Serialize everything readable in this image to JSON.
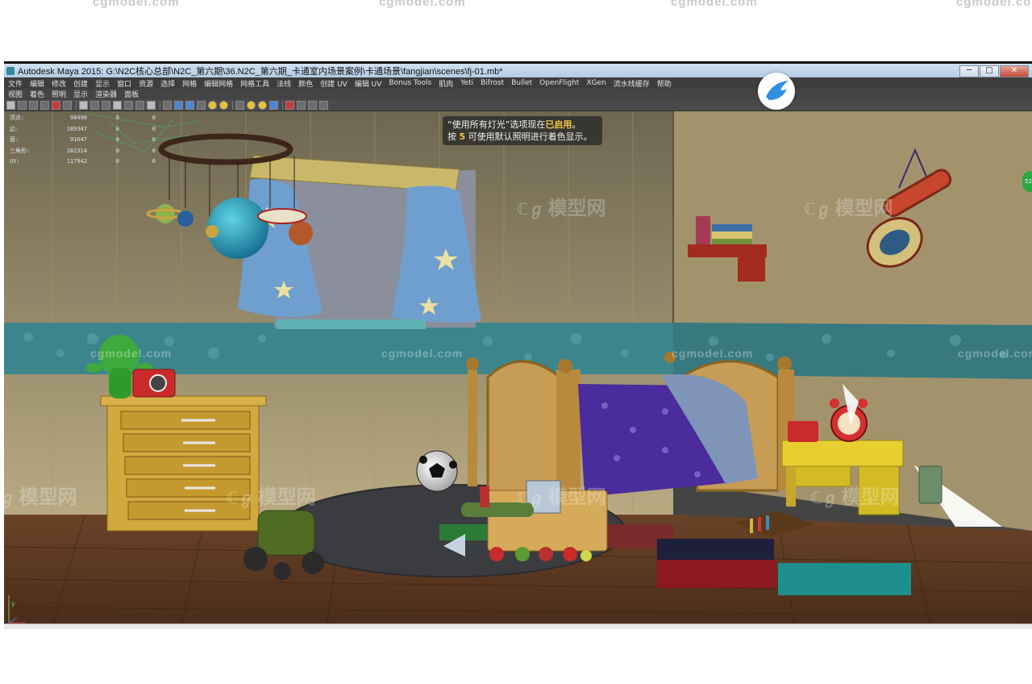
{
  "watermark": {
    "site": "cgmodel.com",
    "cn": "模型网",
    "cn_mark": "ℂℊ"
  },
  "window": {
    "title": "Autodesk Maya 2015: G:\\N2C核心总部\\N2C_第六期\\36.N2C_第六期_卡通室内场景案例\\卡通场景\\fangjian\\scenes\\fj-01.mb*",
    "btn_min": "─",
    "btn_max": "□",
    "btn_close": "✕"
  },
  "menubar": [
    "文件",
    "编辑",
    "修改",
    "创建",
    "显示",
    "窗口",
    "资源",
    "选择",
    "网格",
    "编辑网格",
    "网格工具",
    "法线",
    "颜色",
    "创建 UV",
    "编辑 UV",
    "Bonus Tools",
    "肌肉",
    "Yeti",
    "Bifrost",
    "Bullet",
    "OpenFlight",
    "XGen",
    "流水线缓存",
    "帮助"
  ],
  "panel_menu": [
    "视图",
    "着色",
    "照明",
    "显示",
    "渲染器",
    "面板"
  ],
  "hud": {
    "rows": [
      {
        "label": "顶点:",
        "v1": "98498",
        "v2": "0",
        "v3": "0"
      },
      {
        "label": "边:",
        "v1": "189347",
        "v2": "0",
        "v3": "0"
      },
      {
        "label": "面:",
        "v1": "91647",
        "v2": "0",
        "v3": "0"
      },
      {
        "label": "三角形:",
        "v1": "182314",
        "v2": "0",
        "v3": "0"
      },
      {
        "label": "UV:",
        "v1": "117942",
        "v2": "0",
        "v3": "0"
      }
    ]
  },
  "notice": {
    "line1_pre": "“使用所有灯光”选项现在",
    "line1_hl": "已启用",
    "line1_post": "。",
    "line2_pre": "按 ",
    "line2_key": "5",
    "line2_post": " 可使用默认照明进行着色显示。"
  },
  "side_badge": "52",
  "axis_label": "y",
  "colors": {
    "wall": "#b7a77f",
    "wall_right": "#a99a74",
    "border": "#3f8c93",
    "floor": "#5f3a22",
    "rug": "#3d3f42",
    "blanket": "#4a2c9c"
  }
}
